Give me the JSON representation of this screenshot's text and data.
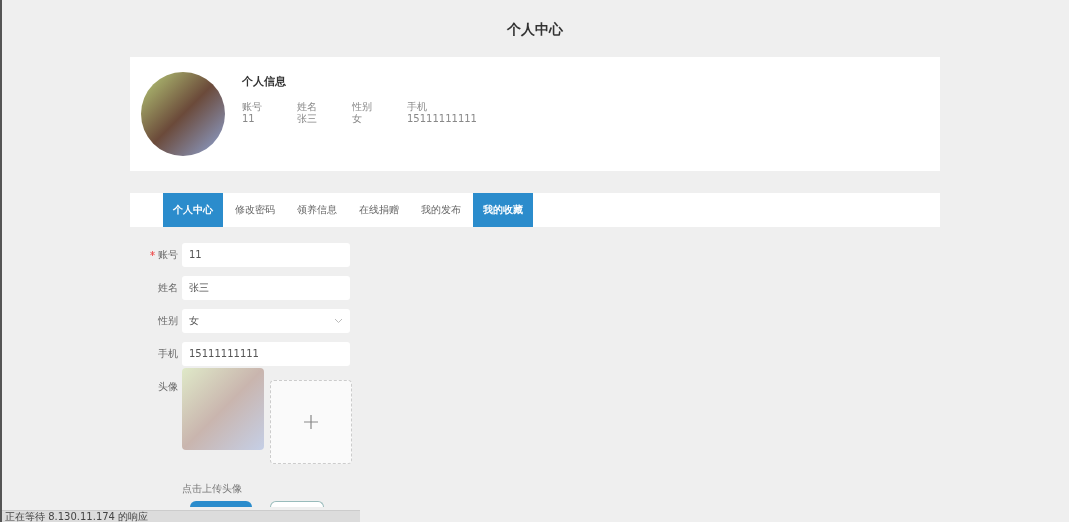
{
  "page_title": "个人中心",
  "profile": {
    "heading": "个人信息",
    "fields": [
      {
        "label": "账号",
        "value": "11"
      },
      {
        "label": "姓名",
        "value": "张三"
      },
      {
        "label": "性别",
        "value": "女"
      },
      {
        "label": "手机",
        "value": "15111111111"
      }
    ]
  },
  "tabs": [
    {
      "label": "个人中心",
      "selected": true
    },
    {
      "label": "修改密码",
      "selected": false
    },
    {
      "label": "领养信息",
      "selected": false
    },
    {
      "label": "在线捐赠",
      "selected": false
    },
    {
      "label": "我的发布",
      "selected": false
    },
    {
      "label": "我的收藏",
      "selected": true
    }
  ],
  "form": [
    {
      "kind": "text",
      "label": "账号",
      "required": true,
      "value": "11"
    },
    {
      "kind": "text",
      "label": "姓名",
      "required": false,
      "value": "张三"
    },
    {
      "kind": "select",
      "label": "性别",
      "required": false,
      "value": "女"
    },
    {
      "kind": "text",
      "label": "手机",
      "required": false,
      "value": "15111111111"
    },
    {
      "kind": "upload",
      "label": "头像",
      "required": false,
      "hint": "点击上传头像"
    }
  ],
  "status_bar": "正在等待 8.130.11.174 的响应"
}
